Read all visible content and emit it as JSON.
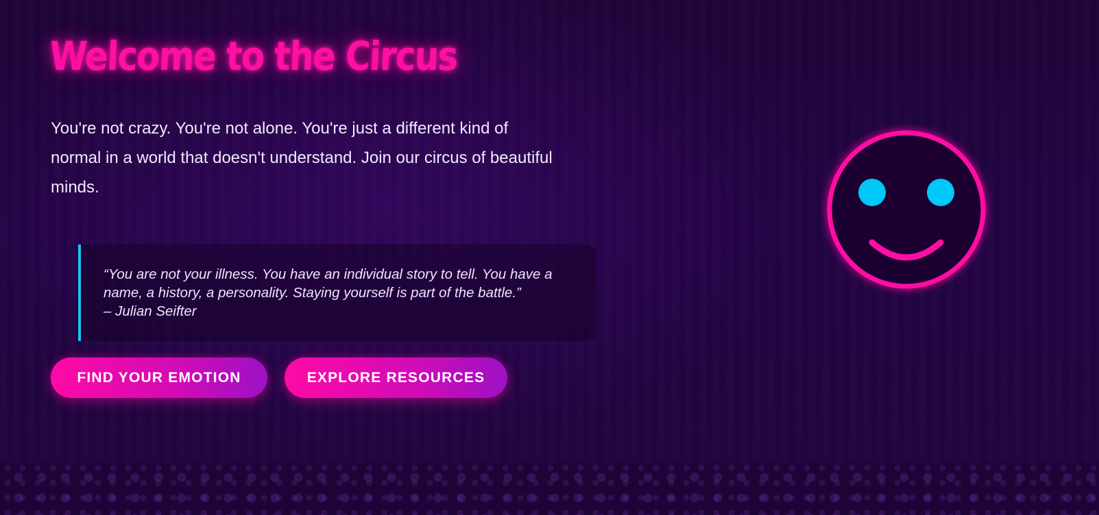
{
  "hero": {
    "title": "Welcome to the Circus",
    "intro": "You're not crazy. You're not alone. You're just a different kind of normal in a world that doesn't understand. Join our circus of beautiful minds.",
    "quote": {
      "text": "“You are not your illness. You have an individual story to tell. You have a name, a history, a personality. Staying yourself is part of the battle.”",
      "author": "– Julian Seifter"
    },
    "buttons": {
      "find_emotion": "FIND YOUR EMOTION",
      "explore_resources": "EXPLORE RESOURCES"
    },
    "illustration": "smiley-face-icon"
  },
  "colors": {
    "background": "#1f053d",
    "neon_pink": "#ff0fa3",
    "cyan": "#00c8f8",
    "button_gradient_end": "#9b12c4",
    "text": "#f3eaff"
  }
}
